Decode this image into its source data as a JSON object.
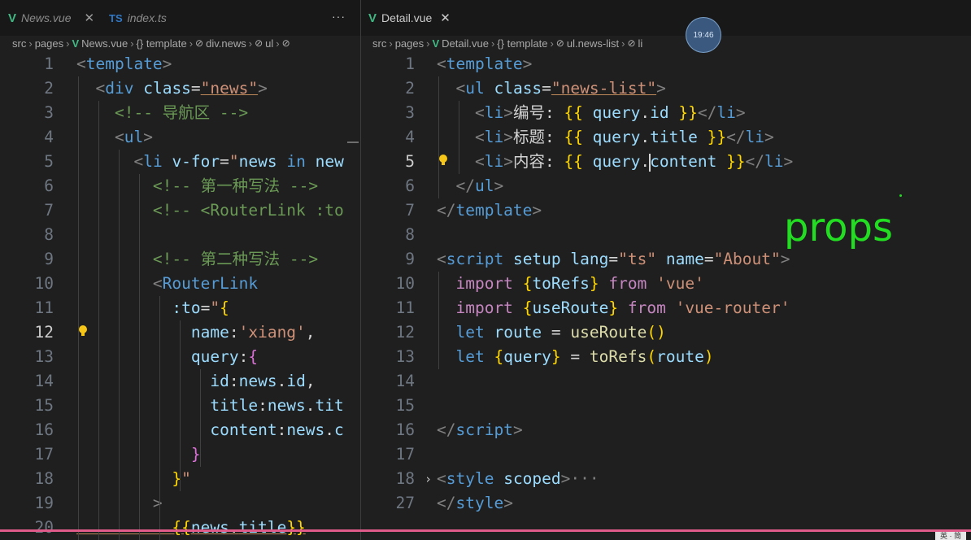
{
  "left": {
    "tabs": [
      {
        "label": "News.vue",
        "icon": "vue-icon",
        "active": false
      },
      {
        "label": "index.ts",
        "icon": "ts-icon",
        "active": false
      }
    ],
    "more_label": "···",
    "breadcrumb": [
      "src",
      "pages",
      "News.vue",
      "{} template",
      "div.news",
      "ul"
    ],
    "lines": [
      {
        "n": "1",
        "code": [
          [
            "t-punc",
            "<"
          ],
          [
            "t-tag",
            "template"
          ],
          [
            "t-punc",
            ">"
          ]
        ]
      },
      {
        "n": "2",
        "code": [
          [
            "t-txt",
            "  "
          ],
          [
            "t-punc",
            "<"
          ],
          [
            "t-tag",
            "div"
          ],
          [
            "t-txt",
            " "
          ],
          [
            "t-attr",
            "class"
          ],
          [
            "t-txt",
            "="
          ],
          [
            "t-str",
            "\"news\""
          ],
          [
            "t-punc",
            ">"
          ]
        ]
      },
      {
        "n": "3",
        "code": [
          [
            "t-txt",
            "    "
          ],
          [
            "t-com",
            "<!-- 导航区 -->"
          ]
        ]
      },
      {
        "n": "4",
        "code": [
          [
            "t-txt",
            "    "
          ],
          [
            "t-punc",
            "<"
          ],
          [
            "t-tag",
            "ul"
          ],
          [
            "t-punc",
            ">"
          ]
        ]
      },
      {
        "n": "5",
        "code": [
          [
            "t-txt",
            "      "
          ],
          [
            "t-punc",
            "<"
          ],
          [
            "t-tag",
            "li"
          ],
          [
            "t-txt",
            " "
          ],
          [
            "t-attr",
            "v-for"
          ],
          [
            "t-txt",
            "="
          ],
          [
            "t-str",
            "\""
          ],
          [
            "t-var",
            "news"
          ],
          [
            "t-txt",
            " "
          ],
          [
            "t-kw2",
            "in"
          ],
          [
            "t-txt",
            " "
          ],
          [
            "t-var",
            "new"
          ]
        ]
      },
      {
        "n": "6",
        "code": [
          [
            "t-txt",
            "        "
          ],
          [
            "t-com",
            "<!-- 第一种写法 -->"
          ]
        ]
      },
      {
        "n": "7",
        "code": [
          [
            "t-txt",
            "        "
          ],
          [
            "t-com",
            "<!-- <RouterLink :to"
          ]
        ]
      },
      {
        "n": "8",
        "code": []
      },
      {
        "n": "9",
        "code": [
          [
            "t-txt",
            "        "
          ],
          [
            "t-com",
            "<!-- 第二种写法 -->"
          ]
        ]
      },
      {
        "n": "10",
        "code": [
          [
            "t-txt",
            "        "
          ],
          [
            "t-punc",
            "<"
          ],
          [
            "t-tag",
            "RouterLink"
          ]
        ]
      },
      {
        "n": "11",
        "code": [
          [
            "t-txt",
            "          "
          ],
          [
            "t-attr",
            ":to"
          ],
          [
            "t-txt",
            "="
          ],
          [
            "t-str",
            "\""
          ],
          [
            "t-br1",
            "{"
          ]
        ]
      },
      {
        "n": "12",
        "code": [
          [
            "t-txt",
            "            "
          ],
          [
            "t-var",
            "name"
          ],
          [
            "t-txt",
            ":"
          ],
          [
            "t-str",
            "'xiang'"
          ],
          [
            "t-txt",
            ","
          ]
        ],
        "active": true
      },
      {
        "n": "13",
        "code": [
          [
            "t-txt",
            "            "
          ],
          [
            "t-var",
            "query"
          ],
          [
            "t-txt",
            ":"
          ],
          [
            "t-br2",
            "{"
          ]
        ]
      },
      {
        "n": "14",
        "code": [
          [
            "t-txt",
            "              "
          ],
          [
            "t-var",
            "id"
          ],
          [
            "t-txt",
            ":"
          ],
          [
            "t-var",
            "news"
          ],
          [
            "t-txt",
            "."
          ],
          [
            "t-var",
            "id"
          ],
          [
            "t-txt",
            ","
          ]
        ]
      },
      {
        "n": "15",
        "code": [
          [
            "t-txt",
            "              "
          ],
          [
            "t-var",
            "title"
          ],
          [
            "t-txt",
            ":"
          ],
          [
            "t-var",
            "news"
          ],
          [
            "t-txt",
            "."
          ],
          [
            "t-var",
            "tit"
          ]
        ]
      },
      {
        "n": "16",
        "code": [
          [
            "t-txt",
            "              "
          ],
          [
            "t-var",
            "content"
          ],
          [
            "t-txt",
            ":"
          ],
          [
            "t-var",
            "news"
          ],
          [
            "t-txt",
            "."
          ],
          [
            "t-var",
            "c"
          ]
        ]
      },
      {
        "n": "17",
        "code": [
          [
            "t-txt",
            "            "
          ],
          [
            "t-br2",
            "}"
          ]
        ]
      },
      {
        "n": "18",
        "code": [
          [
            "t-txt",
            "          "
          ],
          [
            "t-br1",
            "}"
          ],
          [
            "t-str",
            "\""
          ]
        ]
      },
      {
        "n": "19",
        "code": [
          [
            "t-txt",
            "        "
          ],
          [
            "t-punc",
            ">"
          ]
        ]
      },
      {
        "n": "20",
        "code": [
          [
            "t-txt",
            "          "
          ],
          [
            "t-br1",
            "{{"
          ],
          [
            "t-var",
            "news"
          ],
          [
            "t-txt",
            "."
          ],
          [
            "t-var",
            "title"
          ],
          [
            "t-br1",
            "}}"
          ]
        ]
      }
    ]
  },
  "right": {
    "tabs": [
      {
        "label": "Detail.vue",
        "icon": "vue-icon",
        "active": true
      }
    ],
    "breadcrumb": [
      "src",
      "pages",
      "Detail.vue",
      "{} template",
      "ul.news-list",
      "li"
    ],
    "clock": "19:46",
    "lines": [
      {
        "n": "1",
        "code": [
          [
            "t-punc",
            "<"
          ],
          [
            "t-tag",
            "template"
          ],
          [
            "t-punc",
            ">"
          ]
        ]
      },
      {
        "n": "2",
        "code": [
          [
            "t-txt",
            "  "
          ],
          [
            "t-punc",
            "<"
          ],
          [
            "t-tag",
            "ul"
          ],
          [
            "t-txt",
            " "
          ],
          [
            "t-attr",
            "class"
          ],
          [
            "t-txt",
            "="
          ],
          [
            "t-str",
            "\"news-list\""
          ],
          [
            "t-punc",
            ">"
          ]
        ]
      },
      {
        "n": "3",
        "code": [
          [
            "t-txt",
            "    "
          ],
          [
            "t-punc",
            "<"
          ],
          [
            "t-tag",
            "li"
          ],
          [
            "t-punc",
            ">"
          ],
          [
            "t-txt",
            "编号: "
          ],
          [
            "t-br1",
            "{{"
          ],
          [
            "t-txt",
            " "
          ],
          [
            "t-var",
            "query"
          ],
          [
            "t-txt",
            "."
          ],
          [
            "t-var",
            "id"
          ],
          [
            "t-txt",
            " "
          ],
          [
            "t-br1",
            "}}"
          ],
          [
            "t-punc",
            "</"
          ],
          [
            "t-tag",
            "li"
          ],
          [
            "t-punc",
            ">"
          ]
        ]
      },
      {
        "n": "4",
        "code": [
          [
            "t-txt",
            "    "
          ],
          [
            "t-punc",
            "<"
          ],
          [
            "t-tag",
            "li"
          ],
          [
            "t-punc",
            ">"
          ],
          [
            "t-txt",
            "标题: "
          ],
          [
            "t-br1",
            "{{"
          ],
          [
            "t-txt",
            " "
          ],
          [
            "t-var",
            "query"
          ],
          [
            "t-txt",
            "."
          ],
          [
            "t-var",
            "title"
          ],
          [
            "t-txt",
            " "
          ],
          [
            "t-br1",
            "}}"
          ],
          [
            "t-punc",
            "</"
          ],
          [
            "t-tag",
            "li"
          ],
          [
            "t-punc",
            ">"
          ]
        ]
      },
      {
        "n": "5",
        "code": [
          [
            "t-txt",
            "    "
          ],
          [
            "t-punc",
            "<"
          ],
          [
            "t-tag",
            "li"
          ],
          [
            "t-punc",
            ">"
          ],
          [
            "t-txt",
            "内容: "
          ],
          [
            "t-br1",
            "{{"
          ],
          [
            "t-txt",
            " "
          ],
          [
            "t-var",
            "query"
          ],
          [
            "t-txt",
            "."
          ],
          [
            "cursor",
            ""
          ],
          [
            "t-var",
            "content"
          ],
          [
            "t-txt",
            " "
          ],
          [
            "t-br1",
            "}}"
          ],
          [
            "t-punc",
            "</"
          ],
          [
            "t-tag",
            "li"
          ],
          [
            "t-punc",
            ">"
          ]
        ],
        "active": true
      },
      {
        "n": "6",
        "code": [
          [
            "t-txt",
            "  "
          ],
          [
            "t-punc",
            "</"
          ],
          [
            "t-tag",
            "ul"
          ],
          [
            "t-punc",
            ">"
          ]
        ]
      },
      {
        "n": "7",
        "code": [
          [
            "t-punc",
            "</"
          ],
          [
            "t-tag",
            "template"
          ],
          [
            "t-punc",
            ">"
          ]
        ]
      },
      {
        "n": "8",
        "code": []
      },
      {
        "n": "9",
        "code": [
          [
            "t-punc",
            "<"
          ],
          [
            "t-tag",
            "script"
          ],
          [
            "t-txt",
            " "
          ],
          [
            "t-attr",
            "setup"
          ],
          [
            "t-txt",
            " "
          ],
          [
            "t-attr",
            "lang"
          ],
          [
            "t-txt",
            "="
          ],
          [
            "t-str",
            "\"ts\""
          ],
          [
            "t-txt",
            " "
          ],
          [
            "t-attr",
            "name"
          ],
          [
            "t-txt",
            "="
          ],
          [
            "t-str",
            "\"About\""
          ],
          [
            "t-punc",
            ">"
          ]
        ]
      },
      {
        "n": "10",
        "code": [
          [
            "t-txt",
            "  "
          ],
          [
            "t-kw",
            "import"
          ],
          [
            "t-txt",
            " "
          ],
          [
            "t-br1",
            "{"
          ],
          [
            "t-var",
            "toRefs"
          ],
          [
            "t-br1",
            "}"
          ],
          [
            "t-txt",
            " "
          ],
          [
            "t-kw",
            "from"
          ],
          [
            "t-txt",
            " "
          ],
          [
            "t-str",
            "'vue'"
          ]
        ]
      },
      {
        "n": "11",
        "code": [
          [
            "t-txt",
            "  "
          ],
          [
            "t-kw",
            "import"
          ],
          [
            "t-txt",
            " "
          ],
          [
            "t-br1",
            "{"
          ],
          [
            "t-var",
            "useRoute"
          ],
          [
            "t-br1",
            "}"
          ],
          [
            "t-txt",
            " "
          ],
          [
            "t-kw",
            "from"
          ],
          [
            "t-txt",
            " "
          ],
          [
            "t-str",
            "'vue-router'"
          ]
        ]
      },
      {
        "n": "12",
        "code": [
          [
            "t-txt",
            "  "
          ],
          [
            "t-kw2",
            "let"
          ],
          [
            "t-txt",
            " "
          ],
          [
            "t-var",
            "route"
          ],
          [
            "t-txt",
            " = "
          ],
          [
            "t-fn",
            "useRoute"
          ],
          [
            "t-br1",
            "()"
          ]
        ]
      },
      {
        "n": "13",
        "code": [
          [
            "t-txt",
            "  "
          ],
          [
            "t-kw2",
            "let"
          ],
          [
            "t-txt",
            " "
          ],
          [
            "t-br1",
            "{"
          ],
          [
            "t-var",
            "query"
          ],
          [
            "t-br1",
            "}"
          ],
          [
            "t-txt",
            " = "
          ],
          [
            "t-fn",
            "toRefs"
          ],
          [
            "t-br1",
            "("
          ],
          [
            "t-var",
            "route"
          ],
          [
            "t-br1",
            ")"
          ]
        ]
      },
      {
        "n": "14",
        "code": []
      },
      {
        "n": "15",
        "code": []
      },
      {
        "n": "16",
        "code": [
          [
            "t-punc",
            "</"
          ],
          [
            "t-tag",
            "script"
          ],
          [
            "t-punc",
            ">"
          ]
        ]
      },
      {
        "n": "17",
        "code": []
      },
      {
        "n": "18",
        "code": [
          [
            "t-punc",
            "<"
          ],
          [
            "t-tag",
            "style"
          ],
          [
            "t-txt",
            " "
          ],
          [
            "t-attr",
            "scoped"
          ],
          [
            "t-punc",
            ">"
          ],
          [
            "t-punc",
            "···"
          ]
        ],
        "folded": true
      },
      {
        "n": "27",
        "code": [
          [
            "t-punc",
            "</"
          ],
          [
            "t-tag",
            "style"
          ],
          [
            "t-punc",
            ">"
          ]
        ]
      }
    ]
  },
  "overlay": {
    "text": "props"
  },
  "ime_badge": "英 · 简",
  "colors": {
    "accent_green": "#22dd22",
    "record_bar": "#e05a8a",
    "vue": "#41b883",
    "ts": "#3178c6"
  }
}
